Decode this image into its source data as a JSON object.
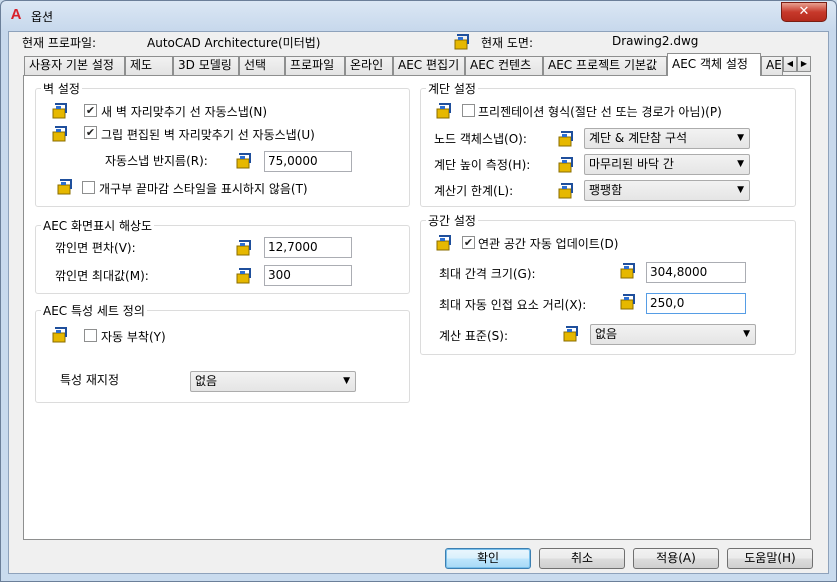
{
  "window": {
    "title": "옵션",
    "close_glyph": "✕"
  },
  "profile": {
    "label": "현재 프로파일:",
    "value": "AutoCAD Architecture(미터법)"
  },
  "drawing": {
    "label": "현재 도면:",
    "value": "Drawing2.dwg"
  },
  "tabs": [
    "사용자 기본 설정",
    "제도",
    "3D 모델링",
    "선택",
    "프로파일",
    "온라인",
    "AEC 편집기",
    "AEC 컨텐츠",
    "AEC 프로젝트 기본값",
    "AEC 객체 설정",
    "AEC"
  ],
  "active_tab": "AEC 객체 설정",
  "wall": {
    "title": "벽 설정",
    "new_wall_snap": "새 벽 자리맞추기 선 자동스냅(N)",
    "grip_wall_snap": "그립 편집된 벽 자리맞추기 선 자동스냅(U)",
    "snap_radius_label": "자동스냅 반지름(R):",
    "snap_radius_value": "75,0000",
    "opening_endcap": "개구부 끝마감 스타일을 표시하지 않음(T)"
  },
  "display": {
    "title": "AEC 화면표시 해상도",
    "facet_dev_label": "깎인면 편차(V):",
    "facet_dev_value": "12,7000",
    "facet_max_label": "깎인면 최대값(M):",
    "facet_max_value": "300"
  },
  "propset": {
    "title": "AEC 특성 세트 정의",
    "auto_attach": "자동 부착(Y)",
    "remap_label": "특성 재지정",
    "remap_value": "없음"
  },
  "stair": {
    "title": "계단 설정",
    "presentation": "프리젠테이션 형식(절단 선 또는 경로가 아님)(P)",
    "node_snap_label": "노드 객체스냅(O):",
    "node_snap_value": "계단 & 계단참 구석",
    "height_label": "계단 높이 측정(H):",
    "height_value": "마무리된 바닥 간",
    "calc_label": "계산기 한계(L):",
    "calc_value": "팽팽함"
  },
  "space": {
    "title": "공간 설정",
    "auto_update": "연관 공간 자동 업데이트(D)",
    "gap_label": "최대 간격 크기(G):",
    "gap_value": "304,8000",
    "adjacent_label": "최대 자동 인접 요소 거리(X):",
    "adjacent_value": "250,0",
    "calc_std_label": "계산 표준(S):",
    "calc_std_value": "없음"
  },
  "buttons": {
    "ok": "확인",
    "cancel": "취소",
    "apply": "적용(A)",
    "help": "도움말(H)"
  },
  "scroll": {
    "left": "◀",
    "right": "▶"
  },
  "checks": {
    "new_wall_snap": true,
    "grip_wall_snap": true,
    "opening_endcap": false,
    "auto_attach": false,
    "presentation": false,
    "auto_update": true
  }
}
